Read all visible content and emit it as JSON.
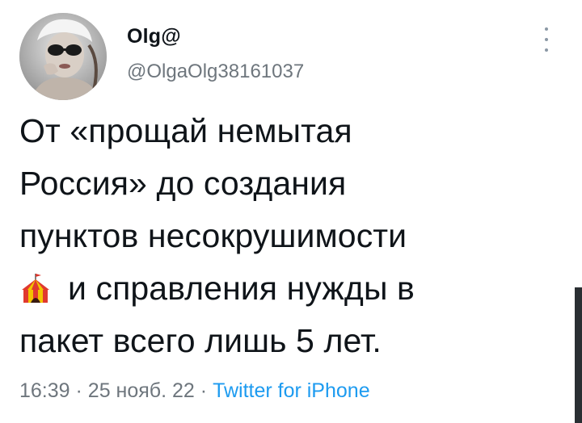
{
  "author": {
    "display_name": "Olg@",
    "handle": "@OlgaOlg38161037"
  },
  "tweet": {
    "lines": [
      "От «прощай немытая",
      "Россия» до создания",
      "пунктов несокрушимости",
      "и справления нужды в",
      "пакет всего лишь 5 лет."
    ],
    "emoji": "circus-tent"
  },
  "meta": {
    "time": "16:39",
    "separator1": "·",
    "date": "25 нояб. 22",
    "separator2": "·",
    "source": "Twitter for iPhone"
  },
  "icons": {
    "more": "more-vertical-icon",
    "emoji": "circus-tent-icon"
  },
  "colors": {
    "text": "#0f1419",
    "secondary": "#6e767d",
    "link": "#1d9bf0"
  }
}
